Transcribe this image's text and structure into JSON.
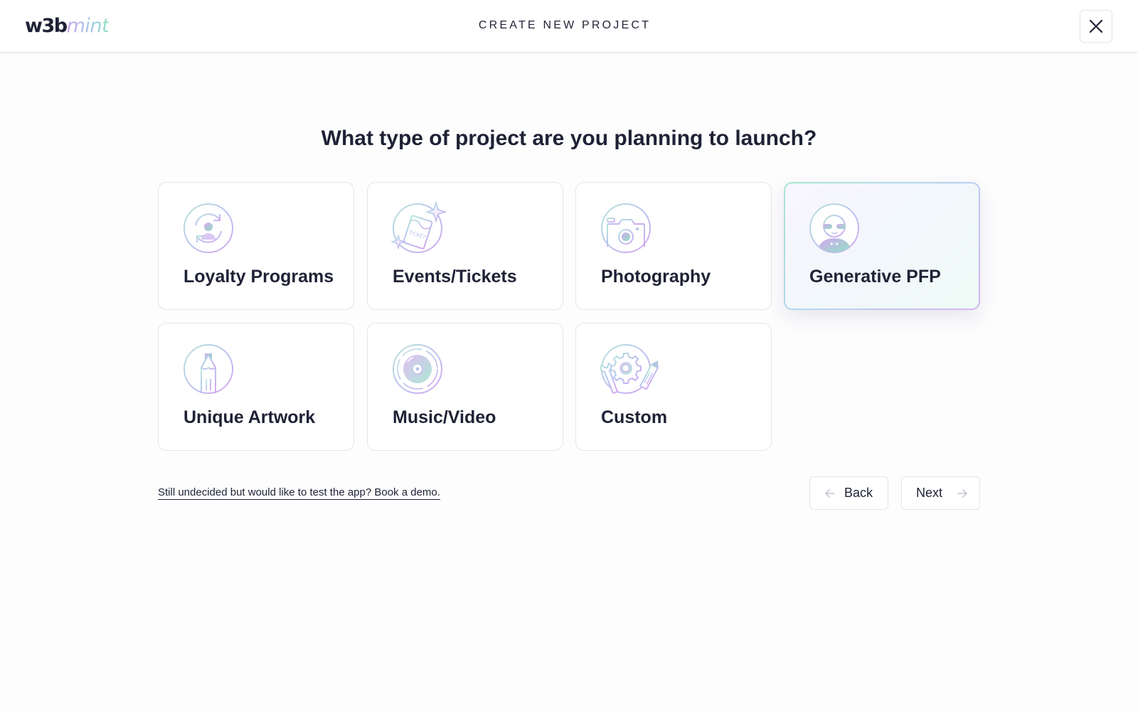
{
  "header": {
    "logo_part1": "w3b",
    "logo_part2": "mint",
    "title": "CREATE NEW PROJECT",
    "close_icon": "close-icon"
  },
  "main": {
    "question": "What type of project are you planning to launch?",
    "cards": [
      {
        "label": "Loyalty Programs",
        "icon": "loyalty-icon",
        "selected": false
      },
      {
        "label": "Events/Tickets",
        "icon": "ticket-icon",
        "selected": false
      },
      {
        "label": "Photography",
        "icon": "camera-icon",
        "selected": false
      },
      {
        "label": "Generative PFP",
        "icon": "pfp-avatar-icon",
        "selected": true
      },
      {
        "label": "Unique Artwork",
        "icon": "pencil-icon",
        "selected": false
      },
      {
        "label": "Music/Video",
        "icon": "disc-icon",
        "selected": false
      },
      {
        "label": "Custom",
        "icon": "gear-tools-icon",
        "selected": false
      }
    ],
    "demo_link": "Still undecided but would like to test the app? Book a demo."
  },
  "footer_nav": {
    "back_label": "Back",
    "next_label": "Next"
  },
  "colors": {
    "text": "#1f2235",
    "accent_purple": "#c9a8f0",
    "accent_mint": "#8fe0c4",
    "card_border": "#e4e5ea"
  }
}
